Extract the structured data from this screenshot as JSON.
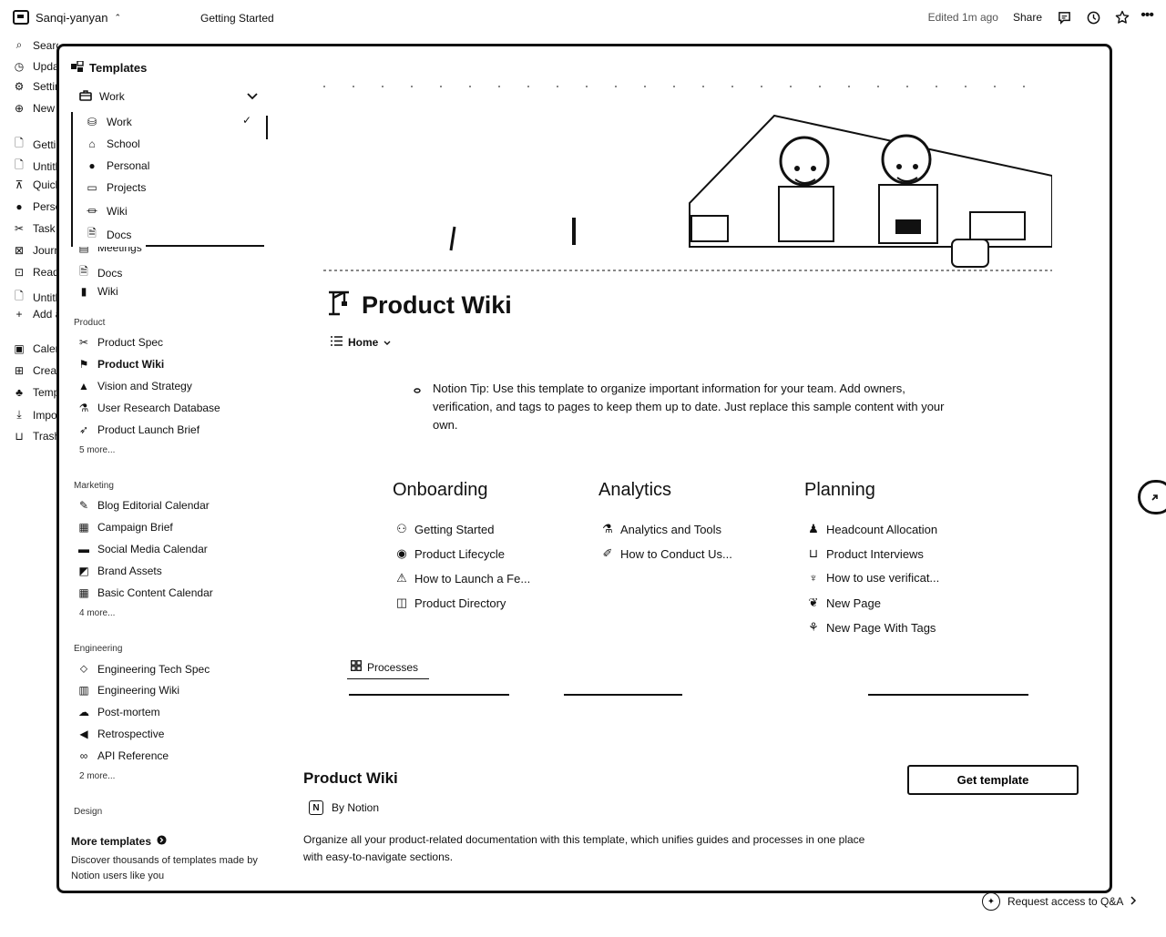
{
  "topbar": {
    "workspace": "Sanqi-yanyan",
    "workspace_chevron": "⌃",
    "breadcrumb": "Getting Started",
    "edited": "Edited 1m ago",
    "share": "Share",
    "icons": [
      "comment-icon",
      "clock-icon",
      "star-icon",
      "more-icon"
    ]
  },
  "bg_sidebar": {
    "items": [
      {
        "icon": "search-icon",
        "glyph": "⌕",
        "label": "Search"
      },
      {
        "icon": "updates-icon",
        "glyph": "◷",
        "label": "Updates"
      },
      {
        "icon": "settings-icon",
        "glyph": "⚙",
        "label": "Settings"
      },
      {
        "icon": "new-page-icon",
        "glyph": "⊕",
        "label": "New page"
      },
      {
        "icon": "page-icon",
        "glyph": "🗋",
        "label": "Getting Started"
      },
      {
        "icon": "page-icon",
        "glyph": "🗋",
        "label": "Untitled"
      },
      {
        "icon": "pin-icon",
        "glyph": "⊼",
        "label": "Quick Note"
      },
      {
        "icon": "person-icon",
        "glyph": "●",
        "label": "Personal Home"
      },
      {
        "icon": "scissors-icon",
        "glyph": "✂",
        "label": "Task List"
      },
      {
        "icon": "journal-icon",
        "glyph": "⊠",
        "label": "Journal"
      },
      {
        "icon": "reading-icon",
        "glyph": "⊡",
        "label": "Reading List"
      },
      {
        "icon": "page-icon",
        "glyph": "🗋",
        "label": "Untitled"
      },
      {
        "icon": "plus-icon",
        "glyph": "+",
        "label": "Add a page"
      },
      {
        "icon": "calendar-icon",
        "glyph": "▣",
        "label": "Calendar"
      },
      {
        "icon": "create-icon",
        "glyph": "⊞",
        "label": "Create a teamspace"
      },
      {
        "icon": "templates-icon",
        "glyph": "♣",
        "label": "Templates"
      },
      {
        "icon": "import-icon",
        "glyph": "⤓",
        "label": "Import"
      },
      {
        "icon": "trash-icon",
        "glyph": "⊔",
        "label": "Trash"
      }
    ]
  },
  "gallery": {
    "title": "Templates",
    "selected_category": "Work",
    "dropdown": [
      {
        "icon": "briefcase-icon",
        "glyph": "⛁",
        "label": "Work",
        "checked": "✓"
      },
      {
        "icon": "school-icon",
        "glyph": "⌂",
        "label": "School"
      },
      {
        "icon": "person-icon",
        "glyph": "●",
        "label": "Personal"
      },
      {
        "icon": "projects-icon",
        "glyph": "▭",
        "label": "Projects"
      },
      {
        "icon": "wiki-icon",
        "glyph": "⏛",
        "label": "Wiki"
      },
      {
        "icon": "docs-icon",
        "glyph": "🗎",
        "label": "Docs"
      }
    ],
    "partial_items": [
      {
        "icon": "meetings-icon",
        "glyph": "▤",
        "label": "Meetings"
      },
      {
        "icon": "docs-icon",
        "glyph": "🗎",
        "label": "Docs"
      },
      {
        "icon": "wiki-icon",
        "glyph": "▮",
        "label": "Wiki"
      }
    ],
    "sections": [
      {
        "title": "Product",
        "items": [
          {
            "icon": "scissors-icon",
            "glyph": "✂",
            "label": "Product Spec"
          },
          {
            "icon": "crane-icon",
            "glyph": "⚑",
            "label": "Product Wiki"
          },
          {
            "icon": "warning-icon",
            "glyph": "▲",
            "label": "Vision and Strategy"
          },
          {
            "icon": "flask-icon",
            "glyph": "⚗",
            "label": "User Research Database"
          },
          {
            "icon": "rocket-icon",
            "glyph": "➶",
            "label": "Product Launch Brief"
          }
        ],
        "more": "5 more..."
      },
      {
        "title": "Marketing",
        "items": [
          {
            "icon": "pen-icon",
            "glyph": "✎",
            "label": "Blog Editorial Calendar"
          },
          {
            "icon": "calendar-icon",
            "glyph": "▦",
            "label": "Campaign Brief"
          },
          {
            "icon": "calendar-icon",
            "glyph": "▬",
            "label": "Social Media Calendar"
          },
          {
            "icon": "assets-icon",
            "glyph": "◩",
            "label": "Brand Assets"
          },
          {
            "icon": "calendar-icon",
            "glyph": "▦",
            "label": "Basic Content Calendar"
          }
        ],
        "more": "4 more..."
      },
      {
        "title": "Engineering",
        "items": [
          {
            "icon": "tag-icon",
            "glyph": "⬦",
            "label": "Engineering Tech Spec"
          },
          {
            "icon": "book-icon",
            "glyph": "▥",
            "label": "Engineering Wiki"
          },
          {
            "icon": "cloud-icon",
            "glyph": "☁",
            "label": "Post-mortem"
          },
          {
            "icon": "rewind-icon",
            "glyph": "◀",
            "label": "Retrospective"
          },
          {
            "icon": "link-icon",
            "glyph": "∞",
            "label": "API Reference"
          }
        ],
        "more": "2 more..."
      },
      {
        "title": "Design",
        "items": [],
        "more": ""
      }
    ],
    "more_templates": "More templates",
    "more_templates_desc": "Discover thousands of templates made by Notion users like you"
  },
  "preview": {
    "title": "Product Wiki",
    "title_icon": "crane-icon",
    "view": "Home",
    "tip": "Notion Tip: Use this template to organize important information for your team. Add owners, verification, and tags to pages to keep them up to date. Just replace this sample content with your own.",
    "columns": [
      {
        "title": "Onboarding",
        "links": [
          {
            "icon": "people-icon",
            "glyph": "⚇",
            "label": "Getting Started"
          },
          {
            "icon": "cycle-icon",
            "glyph": "◉",
            "label": "Product Lifecycle"
          },
          {
            "icon": "warning-icon",
            "glyph": "⚠",
            "label": "How to Launch a Fe..."
          },
          {
            "icon": "directory-icon",
            "glyph": "◫",
            "label": "Product Directory"
          }
        ]
      },
      {
        "title": "Analytics",
        "links": [
          {
            "icon": "chart-icon",
            "glyph": "⚗",
            "label": "Analytics and Tools"
          },
          {
            "icon": "pencil-icon",
            "glyph": "✐",
            "label": "How to Conduct Us..."
          }
        ]
      },
      {
        "title": "Planning",
        "links": [
          {
            "icon": "person-icon",
            "glyph": "♟",
            "label": "Headcount Allocation"
          },
          {
            "icon": "folder-icon",
            "glyph": "⊔",
            "label": "Product Interviews"
          },
          {
            "icon": "palm-icon",
            "glyph": "♆",
            "label": "How to use verificat..."
          },
          {
            "icon": "plant-icon",
            "glyph": "❦",
            "label": "New Page"
          },
          {
            "icon": "sprout-icon",
            "glyph": "⚘",
            "label": "New Page With Tags"
          }
        ]
      }
    ],
    "tab": "Processes"
  },
  "footer": {
    "title": "Product Wiki",
    "by": "By Notion",
    "description": "Organize all your product-related documentation with this template, which unifies guides and processes in one place with easy-to-navigate sections.",
    "cta": "Get template"
  },
  "request_access": "Request access to Q&A"
}
